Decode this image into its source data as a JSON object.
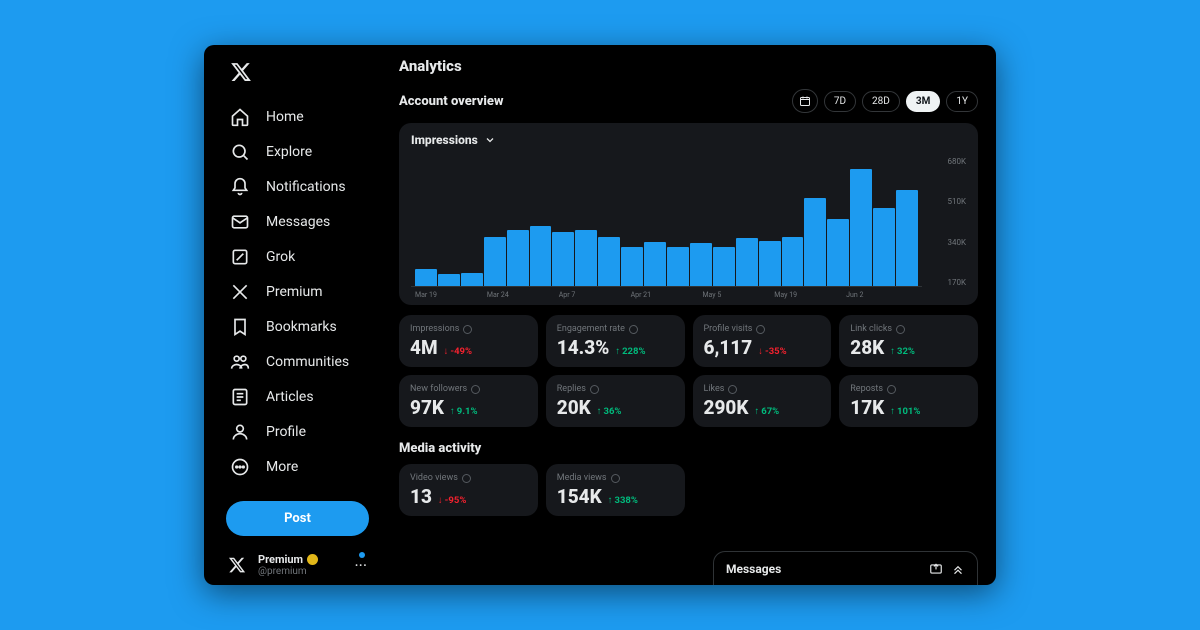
{
  "sidebar": {
    "items": [
      {
        "icon": "home",
        "label": "Home"
      },
      {
        "icon": "search",
        "label": "Explore"
      },
      {
        "icon": "bell",
        "label": "Notifications"
      },
      {
        "icon": "mail",
        "label": "Messages"
      },
      {
        "icon": "grok",
        "label": "Grok"
      },
      {
        "icon": "x",
        "label": "Premium"
      },
      {
        "icon": "bookmark",
        "label": "Bookmarks"
      },
      {
        "icon": "communities",
        "label": "Communities"
      },
      {
        "icon": "articles",
        "label": "Articles"
      },
      {
        "icon": "profile",
        "label": "Profile"
      },
      {
        "icon": "more",
        "label": "More"
      }
    ],
    "post_label": "Post",
    "footer": {
      "name": "Premium",
      "handle": "@premium",
      "verified": true
    }
  },
  "header": {
    "title": "Analytics",
    "overview": "Account overview"
  },
  "ranges": [
    "7D",
    "28D",
    "3M",
    "1Y"
  ],
  "active_range": "3M",
  "chart": {
    "metric": "Impressions"
  },
  "stats": [
    {
      "label": "Impressions",
      "value": "4M",
      "delta": "-49%",
      "dir": "down"
    },
    {
      "label": "Engagement rate",
      "value": "14.3%",
      "delta": "228%",
      "dir": "up"
    },
    {
      "label": "Profile visits",
      "value": "6,117",
      "delta": "-35%",
      "dir": "down"
    },
    {
      "label": "Link clicks",
      "value": "28K",
      "delta": "32%",
      "dir": "up"
    },
    {
      "label": "New followers",
      "value": "97K",
      "delta": "9.1%",
      "dir": "up"
    },
    {
      "label": "Replies",
      "value": "20K",
      "delta": "36%",
      "dir": "up"
    },
    {
      "label": "Likes",
      "value": "290K",
      "delta": "67%",
      "dir": "up"
    },
    {
      "label": "Reposts",
      "value": "17K",
      "delta": "101%",
      "dir": "up"
    }
  ],
  "media_section": {
    "title": "Media activity"
  },
  "media_stats": [
    {
      "label": "Video views",
      "value": "13",
      "delta": "-95%",
      "dir": "down"
    },
    {
      "label": "Media views",
      "value": "154K",
      "delta": "338%",
      "dir": "up"
    }
  ],
  "messages_dock": {
    "title": "Messages"
  },
  "chart_data": {
    "type": "bar",
    "title": "Impressions",
    "ylabel": "",
    "ylim": [
      0,
      680000
    ],
    "yticks": [
      "680K",
      "510K",
      "340K",
      "170K"
    ],
    "xticks": [
      "Mar 19",
      "Mar 24",
      "Apr 7",
      "Apr 21",
      "May 5",
      "May 19",
      "Jun 2"
    ],
    "categories": [
      "b1",
      "b2",
      "b3",
      "b4",
      "b5",
      "b6",
      "b7",
      "b8",
      "b9",
      "b10",
      "b11",
      "b12",
      "b13",
      "b14",
      "b15",
      "b16",
      "b17",
      "b18",
      "b19",
      "b20",
      "b21",
      "b22"
    ],
    "values": [
      90000,
      60000,
      70000,
      255000,
      290000,
      310000,
      280000,
      290000,
      255000,
      200000,
      230000,
      205000,
      225000,
      205000,
      250000,
      235000,
      255000,
      455000,
      350000,
      610000,
      405000,
      500000
    ]
  }
}
